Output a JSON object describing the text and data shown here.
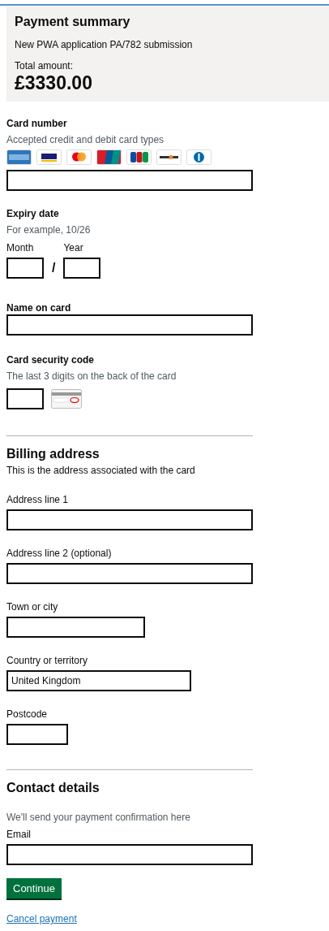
{
  "summary": {
    "title": "Payment summary",
    "description": "New PWA application PA/782 submission",
    "total_label": "Total amount:",
    "total": "£3330.00"
  },
  "card_number": {
    "label": "Card number",
    "hint": "Accepted credit and debit card types"
  },
  "expiry": {
    "label": "Expiry date",
    "hint": "For example, 10/26",
    "month_label": "Month",
    "separator": "/",
    "year_label": "Year"
  },
  "name_on_card": {
    "label": "Name on card"
  },
  "security_code": {
    "label": "Card security code",
    "hint": "The last 3 digits on the back of the card"
  },
  "billing": {
    "heading": "Billing address",
    "hint": "This is the address associated with the card",
    "fields": [
      {
        "label": "Address line 1",
        "kind": "long"
      },
      {
        "label": "Address line 2 (optional)",
        "kind": "long"
      },
      {
        "label": "Town or city",
        "kind": "medium"
      },
      {
        "label": "Country or territory",
        "kind": "wide",
        "value": "United Kingdom"
      },
      {
        "label": "Postcode",
        "kind": "short"
      }
    ]
  },
  "contact": {
    "heading": "Contact details",
    "hint": "We'll send your payment confirmation here",
    "email_label": "Email"
  },
  "continue_button": "Continue",
  "cancel_link": "Cancel payment"
}
